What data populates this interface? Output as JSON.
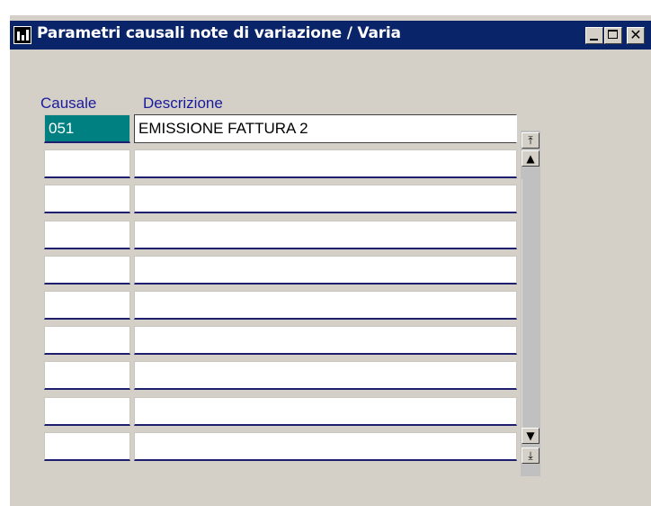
{
  "window": {
    "title": "Parametri causali note di variazione / Varia"
  },
  "headers": {
    "causale": "Causale",
    "descrizione": "Descrizione"
  },
  "rows": [
    {
      "causale": "051",
      "descrizione": "EMISSIONE FATTURA  2"
    },
    {
      "causale": "",
      "descrizione": ""
    },
    {
      "causale": "",
      "descrizione": ""
    },
    {
      "causale": "",
      "descrizione": ""
    },
    {
      "causale": "",
      "descrizione": ""
    },
    {
      "causale": "",
      "descrizione": ""
    },
    {
      "causale": "",
      "descrizione": ""
    },
    {
      "causale": "",
      "descrizione": ""
    },
    {
      "causale": "",
      "descrizione": ""
    },
    {
      "causale": "",
      "descrizione": ""
    }
  ],
  "selected_row": 0,
  "icons": {
    "app": "app-icon",
    "minimize": "minimize-icon",
    "maximize": "maximize-icon",
    "close": "close-icon",
    "scroll_first": "scroll-first-icon",
    "scroll_up": "scroll-up-icon",
    "scroll_down": "scroll-down-icon",
    "scroll_last": "scroll-last-icon"
  },
  "glyphs": {
    "close": "✕",
    "first": "⤒",
    "up": "▲",
    "down": "▼",
    "last": "⤓"
  },
  "colors": {
    "titlebar": "#0a246a",
    "selection": "#008080",
    "header_text": "#1a1a9c",
    "background": "#d4d0c8"
  }
}
